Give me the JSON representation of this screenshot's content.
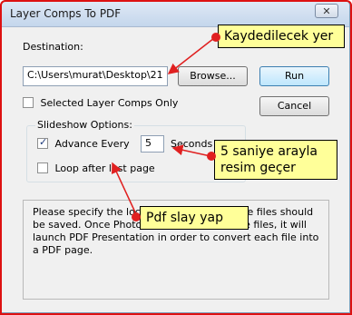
{
  "window": {
    "title": "Layer Comps To PDF",
    "close_glyph": "✕"
  },
  "destination": {
    "label": "Destination:",
    "path_value": "C:\\Users\\murat\\Desktop\\21",
    "browse_label": "Browse..."
  },
  "buttons": {
    "run_label": "Run",
    "cancel_label": "Cancel"
  },
  "selected_only": {
    "label": "Selected Layer Comps Only",
    "checked": false
  },
  "slideshow": {
    "group_label": "Slideshow Options:",
    "advance_label": "Advance Every",
    "advance_checked": true,
    "seconds_value": "5",
    "seconds_label": "Seconds",
    "loop_label": "Loop after last page",
    "loop_checked": false
  },
  "info_text": "Please specify the location where the image files should be saved. Once Photoshop has saved these files, it will launch PDF Presentation in order to convert each file into a PDF page.",
  "annotations": {
    "callout1": "Kaydedilecek yer",
    "callout2": "5 saniye arayla resim geçer",
    "callout3": "Pdf slay yap"
  },
  "colors": {
    "callout_bg": "#ffff99",
    "annotation_red": "#e02020"
  }
}
